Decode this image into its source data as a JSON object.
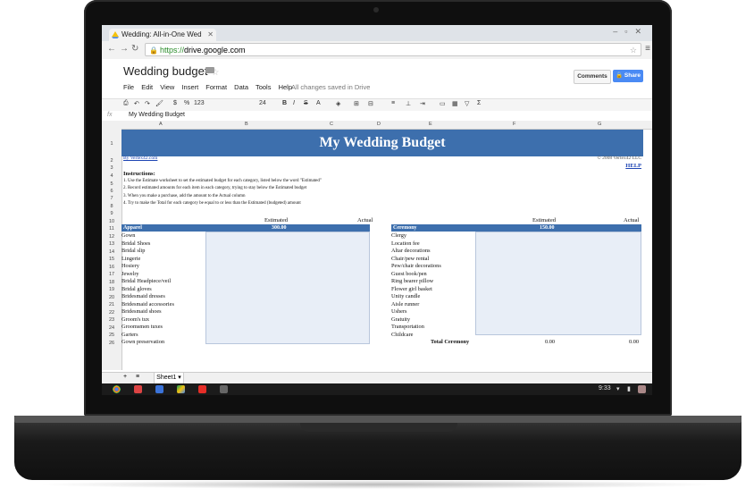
{
  "browser": {
    "tab_title": "Wedding: All-in-One Wed",
    "url_scheme": "https://",
    "url_host": "drive.google.com"
  },
  "docs": {
    "title": "Wedding budget",
    "menu": [
      "File",
      "Edit",
      "View",
      "Insert",
      "Format",
      "Data",
      "Tools",
      "Help"
    ],
    "saved_status": "All changes saved in Drive",
    "comments_label": "Comments",
    "share_label": "Share",
    "zoom": "123",
    "font_size": "24",
    "formula_value": "My Wedding Budget"
  },
  "columns": [
    "A",
    "B",
    "C",
    "D",
    "E",
    "F",
    "G"
  ],
  "rows": [
    "1",
    "2",
    "3",
    "4",
    "5",
    "6",
    "7",
    "8",
    "9",
    "10",
    "11",
    "12",
    "13",
    "14",
    "15",
    "16",
    "17",
    "18",
    "19",
    "20",
    "21",
    "22",
    "23",
    "24",
    "25",
    "26"
  ],
  "sheet": {
    "banner": "My Wedding Budget",
    "link_left": "By Vertex42.com",
    "copyright": "© 2008 Vertex42 LLC",
    "help": "HELP",
    "instructions_title": "Instructions:",
    "instructions": [
      "1. Use the Estimate worksheet to set the estimated budget for each category, listed below the word \"Estimated\"",
      "2. Record estimated amounts for each item in each category, trying to stay below the Estimated budget",
      "3. When you make a purchase, add the amount to the Actual column",
      "4. Try to make the Total for each category be equal to or less than the Estimated (budgeted) amount"
    ],
    "estimated_label": "Estimated",
    "actual_label": "Actual"
  },
  "apparel": {
    "header": "Apparel",
    "estimated": "300.00",
    "items": [
      "Gown",
      "Bridal Shoes",
      "Bridal slip",
      "Lingerie",
      "Hosiery",
      "Jewelry",
      "Bridal Headpiece/veil",
      "Bridal gloves",
      "Bridesmaid dresses",
      "Bridesmaid accessories",
      "Bridesmaid shoes",
      "Groom's tux",
      "Groomsmen tuxes",
      "Garters",
      "Gown preservation"
    ]
  },
  "ceremony": {
    "header": "Ceremony",
    "estimated": "150.00",
    "items": [
      "Clergy",
      "Location fee",
      "Altar decorations",
      "Chair/pew rental",
      "Pew/chair decorations",
      "Guest book/pen",
      "Ring bearer pillow",
      "Flower girl basket",
      "Unity candle",
      "Aisle runner",
      "Ushers",
      "Gratuity",
      "Transportation",
      "Childcare"
    ],
    "total_label": "Total Ceremony",
    "total_estimated": "0.00",
    "total_actual": "0.00"
  },
  "footer": {
    "sheet_tab": "Sheet1",
    "clock": "9:33"
  },
  "colors": {
    "banner": "#3d6fad",
    "share": "#4a8af4",
    "shelf": "#1b1b1b"
  }
}
